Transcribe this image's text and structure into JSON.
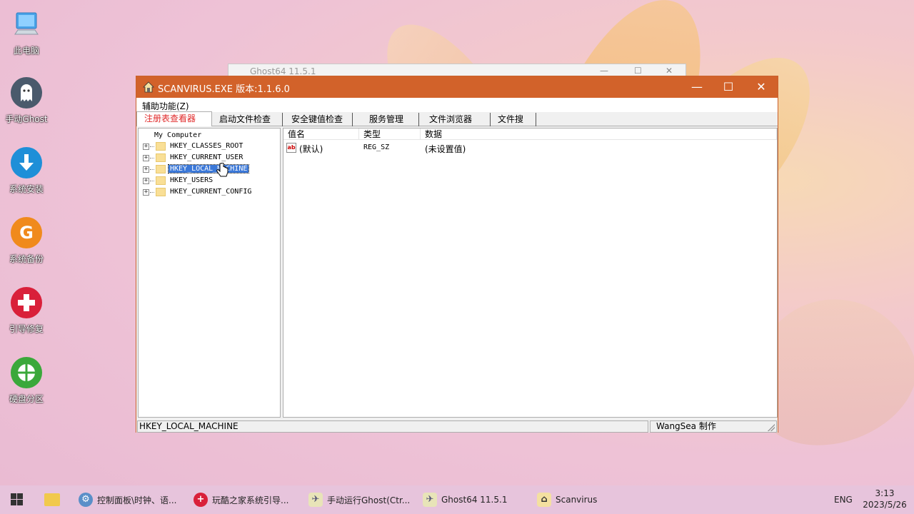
{
  "desktop": {
    "icons": [
      {
        "label": "此电脑",
        "icon": "computer-icon",
        "color": "#3b8ed8"
      },
      {
        "label": "手动Ghost",
        "icon": "ghost-icon",
        "color": "#4a5a6c"
      },
      {
        "label": "系统安装",
        "icon": "download-icon",
        "color": "#1e8fd8"
      },
      {
        "label": "系统备份",
        "icon": "g-icon",
        "color": "#f08a1c"
      },
      {
        "label": "引导修复",
        "icon": "plus-icon",
        "color": "#d9203a"
      },
      {
        "label": "硬盘分区",
        "icon": "pie-icon",
        "color": "#3aa83a"
      }
    ]
  },
  "background_window": {
    "title": "Ghost64 11.5.1"
  },
  "window": {
    "title": "SCANVIRUS.EXE  版本:1.1.6.0",
    "accent": "#d2622a",
    "menu": "辅助功能(Z)",
    "tabs": [
      "注册表查看器",
      "启动文件检查",
      "安全键值检查",
      "服务管理",
      "文件浏览器",
      "文件搜索"
    ],
    "active_tab": "注册表查看器",
    "tree": {
      "root": "My Computer",
      "nodes": [
        "HKEY_CLASSES_ROOT",
        "HKEY_CURRENT_USER",
        "HKEY_LOCAL_MACHINE",
        "HKEY_USERS",
        "HKEY_CURRENT_CONFIG"
      ],
      "selected": "HKEY_LOCAL_MACHINE"
    },
    "list": {
      "columns": [
        "值名",
        "类型",
        "数据"
      ],
      "rows": [
        {
          "name": "(默认)",
          "type": "REG_SZ",
          "data": "(未设置值)",
          "icon": "ab"
        }
      ]
    },
    "status": {
      "path": "HKEY_LOCAL_MACHINE",
      "author": "WangSea 制作"
    }
  },
  "taskbar": {
    "items": [
      {
        "label": "控制面板\\时钟、语...",
        "icon": "control-panel-icon"
      },
      {
        "label": "玩酷之家系统引导...",
        "icon": "plus-icon"
      },
      {
        "label": "手动运行Ghost(Ctr...",
        "icon": "ghost-run-icon"
      },
      {
        "label": "Ghost64 11.5.1",
        "icon": "ghost-app-icon"
      },
      {
        "label": "Scanvirus",
        "icon": "scanvirus-icon"
      }
    ],
    "lang": "ENG",
    "time": "3:13",
    "date": "2023/5/26"
  }
}
